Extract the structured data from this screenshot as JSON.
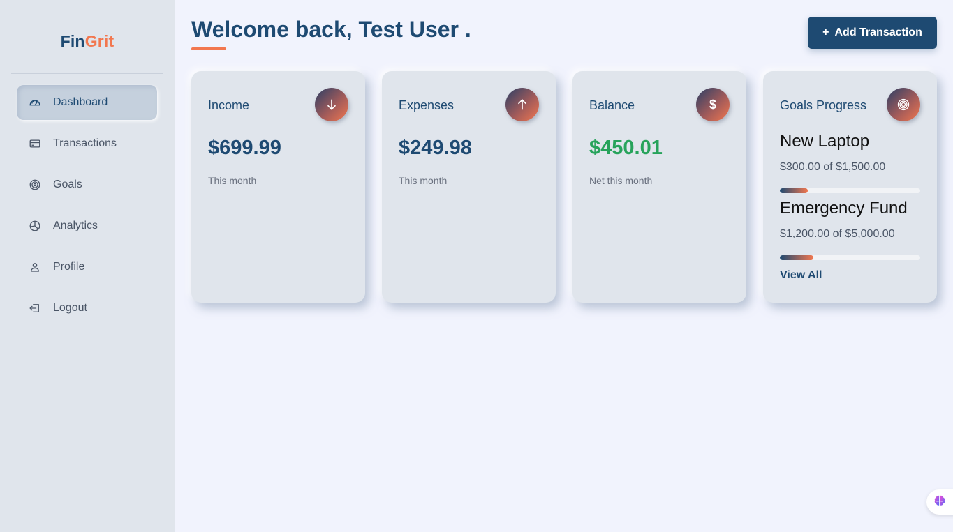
{
  "brand": {
    "part1": "Fin",
    "part2": "Grit",
    "accent": "#f2774f",
    "primary": "#1e4a72"
  },
  "sidebar": {
    "items": [
      {
        "label": "Dashboard",
        "icon": "gauge-icon",
        "active": true
      },
      {
        "label": "Transactions",
        "icon": "credit-card-icon"
      },
      {
        "label": "Goals",
        "icon": "target-icon"
      },
      {
        "label": "Analytics",
        "icon": "pie-chart-icon"
      },
      {
        "label": "Profile",
        "icon": "user-icon"
      },
      {
        "label": "Logout",
        "icon": "logout-icon"
      }
    ]
  },
  "header": {
    "welcome": "Welcome back, Test User .",
    "add_button": "Add Transaction",
    "add_button_icon": "plus-icon"
  },
  "cards": {
    "income": {
      "title": "Income",
      "value": "$699.99",
      "sub": "This month",
      "icon": "arrow-down-icon"
    },
    "expenses": {
      "title": "Expenses",
      "value": "$249.98",
      "sub": "This month",
      "icon": "arrow-up-icon"
    },
    "balance": {
      "title": "Balance",
      "value": "$450.01",
      "sub": "Net this month",
      "icon": "dollar-icon",
      "value_color": "#27a35b"
    },
    "goals": {
      "title": "Goals Progress",
      "icon": "target-icon",
      "items": [
        {
          "name": "New Laptop",
          "amount": "$300.00 of $1,500.00",
          "progress": 0.2
        },
        {
          "name": "Emergency Fund",
          "amount": "$1,200.00 of $5,000.00",
          "progress": 0.24
        }
      ],
      "view_all": "View All"
    }
  },
  "assistant_button": {
    "icon": "brain-icon"
  }
}
